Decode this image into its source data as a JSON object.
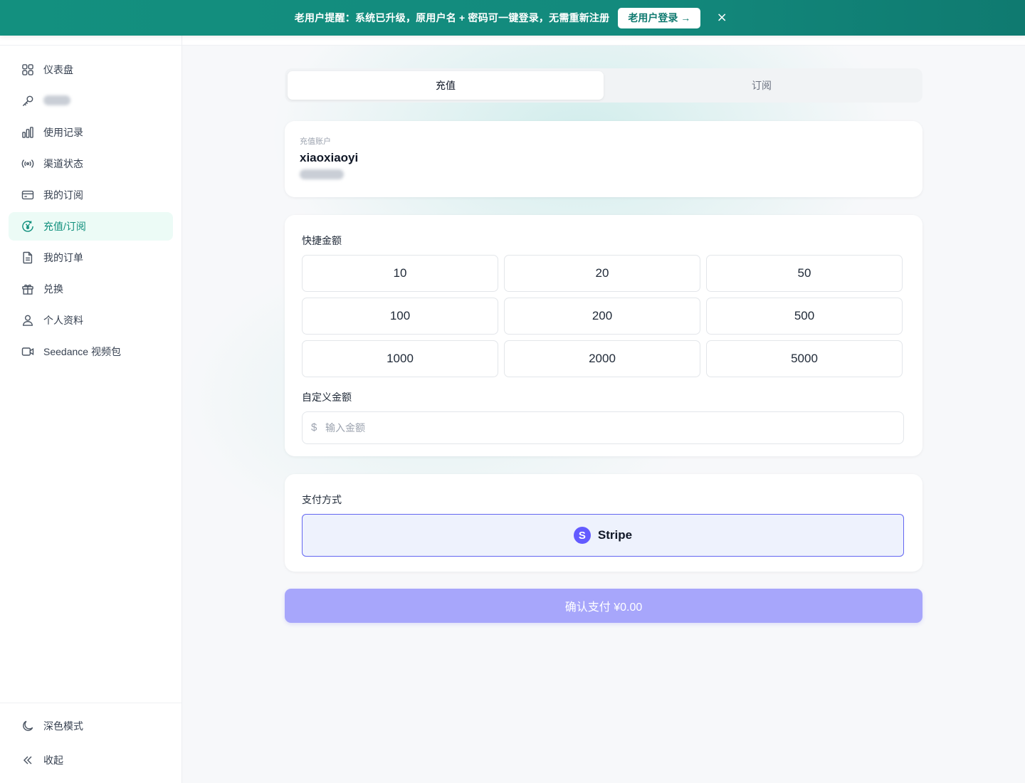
{
  "banner": {
    "text": "老用户提醒：系统已升级，原用户名 + 密码可一键登录，无需重新注册",
    "button_label": "老用户登录 →",
    "close_label": "×"
  },
  "sidebar": {
    "items": [
      {
        "label": "仪表盘",
        "icon": "dashboard-grid-icon"
      },
      {
        "label": "",
        "icon": "key-icon",
        "blurred": true
      },
      {
        "label": "使用记录",
        "icon": "bar-chart-icon"
      },
      {
        "label": "渠道状态",
        "icon": "broadcast-icon"
      },
      {
        "label": "我的订阅",
        "icon": "credit-card-icon"
      },
      {
        "label": "充值/订阅",
        "icon": "yen-circle-icon",
        "active": true
      },
      {
        "label": "我的订单",
        "icon": "document-icon"
      },
      {
        "label": "兑换",
        "icon": "gift-icon"
      },
      {
        "label": "个人资料",
        "icon": "user-icon"
      },
      {
        "label": "Seedance 视频包",
        "icon": "video-camera-icon"
      }
    ],
    "footer": {
      "dark_mode_label": "深色模式",
      "collapse_label": "收起"
    }
  },
  "tabs": {
    "recharge": "充值",
    "subscribe": "订阅",
    "active": "recharge"
  },
  "account": {
    "label": "充值账户",
    "username": "xiaoxiaoyi"
  },
  "quick_amount": {
    "title": "快捷金额",
    "amounts": [
      "10",
      "20",
      "50",
      "100",
      "200",
      "500",
      "1000",
      "2000",
      "5000"
    ]
  },
  "custom_amount": {
    "title": "自定义金额",
    "currency_symbol": "$",
    "placeholder": "输入金额",
    "value": ""
  },
  "payment": {
    "title": "支付方式",
    "method_label": "Stripe",
    "method_icon_letter": "S"
  },
  "confirm": {
    "label": "确认支付 ¥0.00"
  },
  "colors": {
    "brand": "#13907f",
    "active_nav": "#0f8f7c",
    "stripe": "#635bff",
    "confirm_bg": "#a7a6fb"
  }
}
